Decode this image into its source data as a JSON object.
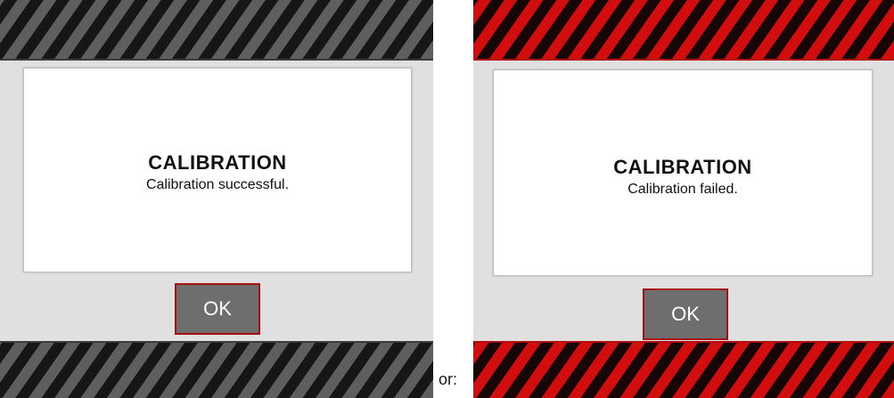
{
  "dialogs": [
    {
      "title": "CALIBRATION",
      "message": "Calibration successful.",
      "ok_label": "OK",
      "stripe_colors": [
        "#5e5e5e",
        "#161616"
      ]
    },
    {
      "title": "CALIBRATION",
      "message": "Calibration failed.",
      "ok_label": "OK",
      "stripe_colors": [
        "#d10d0d",
        "#160606"
      ]
    }
  ],
  "separator_text": "or:"
}
